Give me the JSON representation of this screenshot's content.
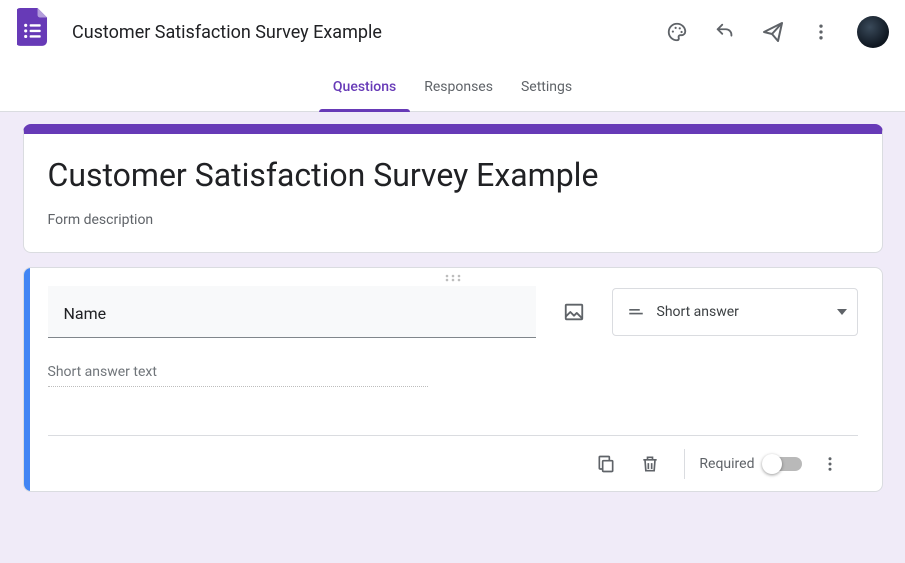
{
  "header": {
    "doc_title": "Customer Satisfaction Survey Example"
  },
  "tabs": {
    "questions": "Questions",
    "responses": "Responses",
    "settings": "Settings",
    "active": "questions"
  },
  "form": {
    "title": "Customer Satisfaction Survey Example",
    "description_placeholder": "Form description"
  },
  "question": {
    "title_value": "Name",
    "type_label": "Short answer",
    "answer_placeholder": "Short answer text",
    "required_label": "Required",
    "required": false
  },
  "colors": {
    "accent": "#673ab7",
    "question_accent": "#4285f4"
  }
}
